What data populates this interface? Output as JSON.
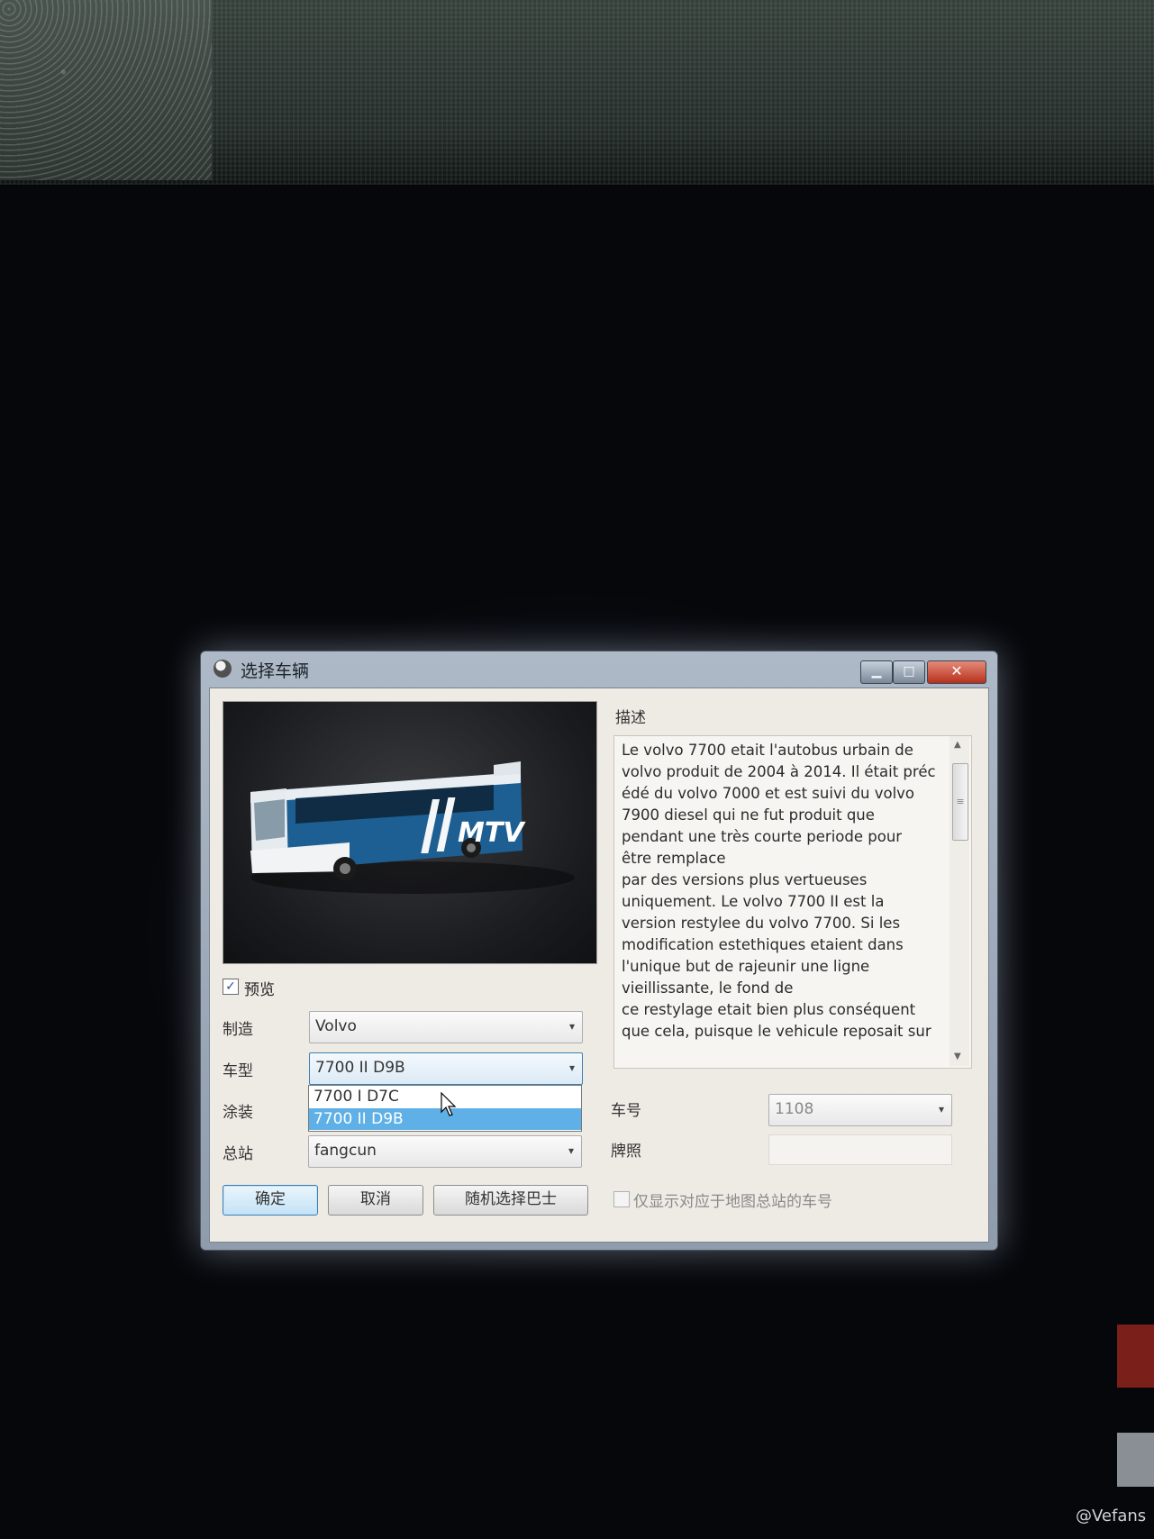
{
  "window": {
    "title": "选择车辆",
    "minimize_glyph": "▁",
    "maximize_glyph": "□",
    "close_glyph": "✕"
  },
  "preview": {
    "bus_livery_text": "MTV",
    "checkbox_label": "预览",
    "checkbox_checked": true,
    "checkbox_glyph": "✓"
  },
  "description": {
    "label": "描述",
    "text": "Le volvo 7700 etait l'autobus urbain de\nvolvo produit de 2004 à 2014. Il était préc\nédé du volvo 7000 et est suivi du volvo\n7900 diesel qui ne fut produit que\npendant une très courte periode pour\nêtre remplace\npar des versions plus vertueuses\nuniquement. Le volvo 7700 II est la\nversion restylee du volvo 7700. Si les\nmodification estethiques etaient dans\nl'unique but de rajeunir une ligne\nvieillissante, le fond de\nce restylage etait bien plus conséquent\nque cela, puisque le vehicule reposait sur"
  },
  "form": {
    "manufacturer_label": "制造",
    "manufacturer_value": "Volvo",
    "model_label": "车型",
    "model_value": "7700 II D9B",
    "model_options": [
      "7700 I D7C",
      "7700 II D9B"
    ],
    "model_selected_index": 1,
    "livery_label": "涂装",
    "terminal_label": "总站",
    "terminal_value": "fangcun",
    "vehicle_number_label": "车号",
    "vehicle_number_value": "1108",
    "plate_label": "牌照",
    "plate_value": ""
  },
  "buttons": {
    "ok": "确定",
    "cancel": "取消",
    "random": "随机选择巴士"
  },
  "filter_checkbox": {
    "label": "仅显示对应于地图总站的车号",
    "checked": false
  },
  "icons": {
    "dropdown_arrow": "▾",
    "scroll_up": "▲",
    "scroll_down": "▼",
    "scroll_grip": "≡"
  },
  "watermark": "@Vefans",
  "colors": {
    "selection": "#5fb0e6",
    "close_button": "#c8412c",
    "bus_blue": "#1e5f93"
  }
}
